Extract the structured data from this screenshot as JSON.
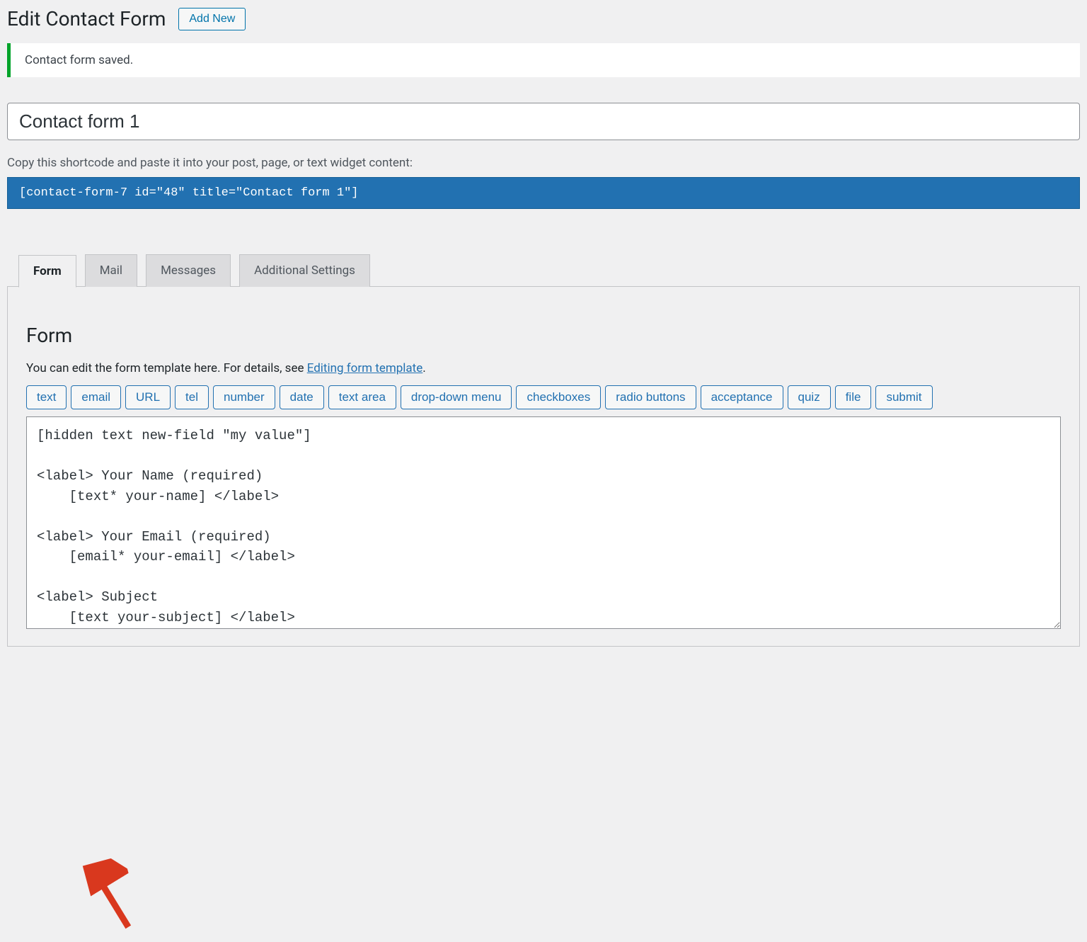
{
  "header": {
    "title": "Edit Contact Form",
    "add_new": "Add New"
  },
  "notice": {
    "message": "Contact form saved."
  },
  "form_title_input": {
    "value": "Contact form 1"
  },
  "shortcode": {
    "label": "Copy this shortcode and paste it into your post, page, or text widget content:",
    "value": "[contact-form-7 id=\"48\" title=\"Contact form 1\"]"
  },
  "tabs": [
    {
      "label": "Form",
      "active": true
    },
    {
      "label": "Mail",
      "active": false
    },
    {
      "label": "Messages",
      "active": false
    },
    {
      "label": "Additional Settings",
      "active": false
    }
  ],
  "form_panel": {
    "heading": "Form",
    "description_pre": "You can edit the form template here. For details, see ",
    "description_link": "Editing form template",
    "description_post": ".",
    "tag_buttons": [
      "text",
      "email",
      "URL",
      "tel",
      "number",
      "date",
      "text area",
      "drop-down menu",
      "checkboxes",
      "radio buttons",
      "acceptance",
      "quiz",
      "file",
      "submit"
    ],
    "editor_value": "[hidden text new-field \"my value\"]\n\n<label> Your Name (required)\n    [text* your-name] </label>\n\n<label> Your Email (required)\n    [email* your-email] </label>\n\n<label> Subject\n    [text your-subject] </label>"
  }
}
